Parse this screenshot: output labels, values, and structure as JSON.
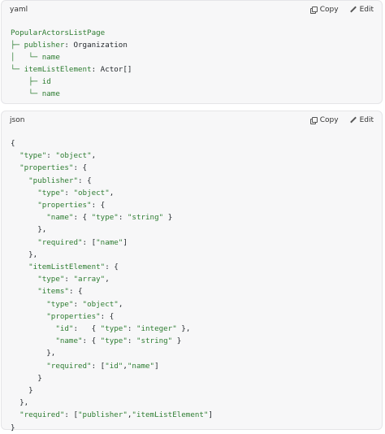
{
  "yaml_block": {
    "language": "yaml",
    "copy_label": "Copy",
    "edit_label": "Edit",
    "lines": [
      {
        "tree": "",
        "name": "PopularActorsListPage",
        "rest": ""
      },
      {
        "tree": "├─ ",
        "name": "publisher",
        "rest": ": Organization"
      },
      {
        "tree": "│   └─ ",
        "name": "name",
        "rest": ""
      },
      {
        "tree": "└─ ",
        "name": "itemListElement",
        "rest": ": Actor[]"
      },
      {
        "tree": "    ├─ ",
        "name": "id",
        "rest": ""
      },
      {
        "tree": "    └─ ",
        "name": "name",
        "rest": ""
      }
    ]
  },
  "json_block": {
    "language": "json",
    "copy_label": "Copy",
    "edit_label": "Edit",
    "lines": [
      "{",
      "  \"type\": \"object\",",
      "  \"properties\": {",
      "    \"publisher\": {",
      "      \"type\": \"object\",",
      "      \"properties\": {",
      "        \"name\": { \"type\": \"string\" }",
      "      },",
      "      \"required\": [\"name\"]",
      "    },",
      "    \"itemListElement\": {",
      "      \"type\": \"array\",",
      "      \"items\": {",
      "        \"type\": \"object\",",
      "        \"properties\": {",
      "          \"id\":   { \"type\": \"integer\" },",
      "          \"name\": { \"type\": \"string\" }",
      "        },",
      "        \"required\": [\"id\",\"name\"]",
      "      }",
      "    }",
      "  },",
      "  \"required\": [\"publisher\",\"itemListElement\"]",
      "}"
    ]
  },
  "colors": {
    "string": "#2e7d32",
    "punctuation": "#24292e",
    "card_bg": "#f7f7f8"
  }
}
